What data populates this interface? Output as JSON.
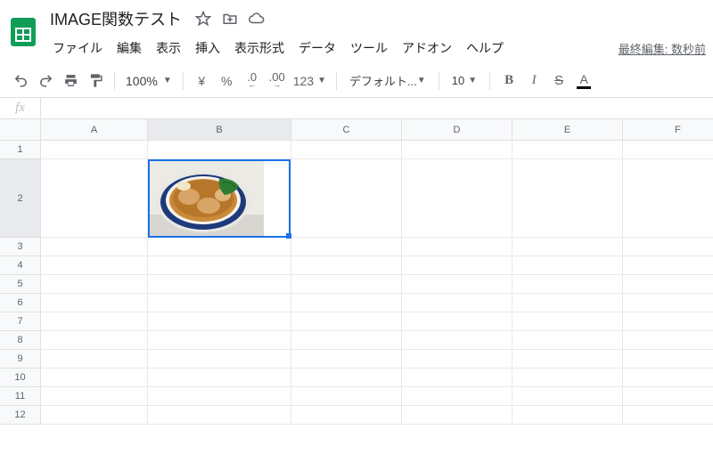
{
  "doc_title": "IMAGE関数テスト",
  "menus": {
    "file": "ファイル",
    "edit": "編集",
    "view": "表示",
    "insert": "挿入",
    "format": "表示形式",
    "data": "データ",
    "tools": "ツール",
    "addons": "アドオン",
    "help": "ヘルプ"
  },
  "last_edit": "最終編集: 数秒前",
  "toolbar": {
    "zoom": "100%",
    "currency": "¥",
    "percent": "%",
    "dec_less": ".0",
    "dec_more": ".00",
    "more_formats": "123",
    "font": "デフォルト...",
    "font_size": "10",
    "bold": "B",
    "italic": "I",
    "strike": "S",
    "text_color": "A"
  },
  "fx_label": "fx",
  "columns": [
    "A",
    "B",
    "C",
    "D",
    "E",
    "F"
  ],
  "rows": [
    "1",
    "2",
    "3",
    "4",
    "5",
    "6",
    "7",
    "8",
    "9",
    "10",
    "11",
    "12"
  ],
  "selected_cell": "B2",
  "cell_image_alt": "ramen-bowl"
}
